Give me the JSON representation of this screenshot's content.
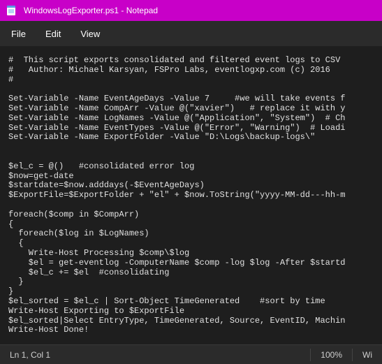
{
  "window": {
    "title": "WindowsLogExporter.ps1 - Notepad"
  },
  "menubar": {
    "file": "File",
    "edit": "Edit",
    "view": "View"
  },
  "editor": {
    "content": "#  This script exports consolidated and filtered event logs to CSV\n#   Author: Michael Karsyan, FSPro Labs, eventlogxp.com (c) 2016\n#\n\nSet-Variable -Name EventAgeDays -Value 7     #we will take events f\nSet-Variable -Name CompArr -Value @(\"xavier\")   # replace it with y\nSet-Variable -Name LogNames -Value @(\"Application\", \"System\")  # Ch\nSet-Variable -Name EventTypes -Value @(\"Error\", \"Warning\")  # Loadi\nSet-Variable -Name ExportFolder -Value \"D:\\Logs\\backup-logs\\\"\n\n\n$el_c = @()   #consolidated error log\n$now=get-date\n$startdate=$now.adddays(-$EventAgeDays)\n$ExportFile=$ExportFolder + \"el\" + $now.ToString(\"yyyy-MM-dd---hh-m\n\nforeach($comp in $CompArr)\n{\n  foreach($log in $LogNames)\n  {\n    Write-Host Processing $comp\\$log\n    $el = get-eventlog -ComputerName $comp -log $log -After $startd\n    $el_c += $el  #consolidating\n  }\n}\n$el_sorted = $el_c | Sort-Object TimeGenerated    #sort by time\nWrite-Host Exporting to $ExportFile\n$el_sorted|Select EntryType, TimeGenerated, Source, EventID, Machin\nWrite-Host Done!"
  },
  "statusbar": {
    "position": "Ln 1, Col 1",
    "zoom": "100%",
    "lineending": "Wi"
  }
}
